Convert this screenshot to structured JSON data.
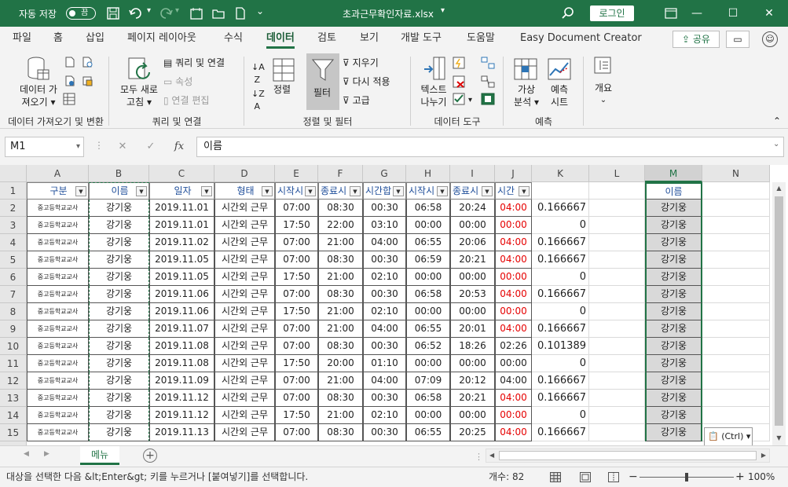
{
  "titlebar": {
    "autosave_label": "자동 저장",
    "autosave_state": "끔",
    "filename": "초과근무확인자료.xlsx",
    "login": "로그인"
  },
  "menu": [
    "파일",
    "홈",
    "삽입",
    "페이지 레이아웃",
    "수식",
    "데이터",
    "검토",
    "보기",
    "개발 도구",
    "도움말",
    "Easy Document Creator"
  ],
  "menu_active": "데이터",
  "share": "공유",
  "ribbon": {
    "get_data": [
      "데이터 가",
      "져오기"
    ],
    "refresh_all": [
      "모두 새로",
      "고침"
    ],
    "queries": "쿼리 및 연결",
    "properties": "속성",
    "edit_links": "연결 편집",
    "sort": "정렬",
    "filter": "필터",
    "clear": "지우기",
    "reapply": "다시 적용",
    "advanced": "고급",
    "text_to_col": [
      "텍스트",
      "나누기"
    ],
    "whatif": [
      "가상",
      "분석"
    ],
    "forecast": [
      "예측",
      "시트"
    ],
    "outline": "개요",
    "groups": [
      "데이터 가져오기 및 변환",
      "쿼리 및 연결",
      "정렬 및 필터",
      "데이터 도구",
      "예측"
    ]
  },
  "formula_bar": {
    "namebox": "M1",
    "fx": "fx",
    "value": "이름"
  },
  "columns": [
    "A",
    "B",
    "C",
    "D",
    "E",
    "F",
    "G",
    "H",
    "I",
    "J",
    "K",
    "L",
    "M",
    "N"
  ],
  "header": [
    "구분",
    "이름",
    "일자",
    "형태",
    "시작시",
    "종료시",
    "시간합",
    "시작시",
    "종료시",
    "시간"
  ],
  "rows": [
    [
      "중고등학교교사",
      "강기웅",
      "2019.11.01",
      "시간외 근무",
      "07:00",
      "08:30",
      "00:30",
      "06:58",
      "20:24",
      "04:00",
      "0.166667"
    ],
    [
      "중고등학교교사",
      "강기웅",
      "2019.11.01",
      "시간외 근무",
      "17:50",
      "22:00",
      "03:10",
      "00:00",
      "00:00",
      "00:00",
      "0"
    ],
    [
      "중고등학교교사",
      "강기웅",
      "2019.11.02",
      "시간외 근무",
      "07:00",
      "21:00",
      "04:00",
      "06:55",
      "20:06",
      "04:00",
      "0.166667"
    ],
    [
      "중고등학교교사",
      "강기웅",
      "2019.11.05",
      "시간외 근무",
      "07:00",
      "08:30",
      "00:30",
      "06:59",
      "20:21",
      "04:00",
      "0.166667"
    ],
    [
      "중고등학교교사",
      "강기웅",
      "2019.11.05",
      "시간외 근무",
      "17:50",
      "21:00",
      "02:10",
      "00:00",
      "00:00",
      "00:00",
      "0"
    ],
    [
      "중고등학교교사",
      "강기웅",
      "2019.11.06",
      "시간외 근무",
      "07:00",
      "08:30",
      "00:30",
      "06:58",
      "20:53",
      "04:00",
      "0.166667"
    ],
    [
      "중고등학교교사",
      "강기웅",
      "2019.11.06",
      "시간외 근무",
      "17:50",
      "21:00",
      "02:10",
      "00:00",
      "00:00",
      "00:00",
      "0"
    ],
    [
      "중고등학교교사",
      "강기웅",
      "2019.11.07",
      "시간외 근무",
      "07:00",
      "21:00",
      "04:00",
      "06:55",
      "20:01",
      "04:00",
      "0.166667"
    ],
    [
      "중고등학교교사",
      "강기웅",
      "2019.11.08",
      "시간외 근무",
      "07:00",
      "08:30",
      "00:30",
      "06:52",
      "18:26",
      "02:26",
      "0.101389"
    ],
    [
      "중고등학교교사",
      "강기웅",
      "2019.11.08",
      "시간외 근무",
      "17:50",
      "20:00",
      "01:10",
      "00:00",
      "00:00",
      "00:00",
      "0"
    ],
    [
      "중고등학교교사",
      "강기웅",
      "2019.11.09",
      "시간외 근무",
      "07:00",
      "21:00",
      "04:00",
      "07:09",
      "20:12",
      "04:00",
      "0.166667"
    ],
    [
      "중고등학교교사",
      "강기웅",
      "2019.11.12",
      "시간외 근무",
      "07:00",
      "08:30",
      "00:30",
      "06:58",
      "20:21",
      "04:00",
      "0.166667"
    ],
    [
      "중고등학교교사",
      "강기웅",
      "2019.11.12",
      "시간외 근무",
      "17:50",
      "21:00",
      "02:10",
      "00:00",
      "00:00",
      "00:00",
      "0"
    ],
    [
      "중고등학교교사",
      "강기웅",
      "2019.11.13",
      "시간외 근무",
      "07:00",
      "08:30",
      "00:30",
      "06:55",
      "20:25",
      "04:00",
      "0.166667"
    ]
  ],
  "red_j_rows": [
    0,
    1,
    2,
    3,
    4,
    5,
    6,
    7,
    11,
    12,
    13
  ],
  "m_header": "이름",
  "m_values": [
    "강기웅",
    "강기웅",
    "강기웅",
    "강기웅",
    "강기웅",
    "강기웅",
    "강기웅",
    "강기웅",
    "강기웅",
    "강기웅",
    "강기웅",
    "강기웅",
    "강기웅",
    "강기웅"
  ],
  "paste_ctrl": "(Ctrl)",
  "sheet_tab": "메뉴",
  "status": {
    "message": "대상을 선택한 다음 &lt;Enter&gt; 키를 누르거나 [붙여넣기]를 선택합니다.",
    "count": "개수: 82",
    "zoom": "100%"
  }
}
